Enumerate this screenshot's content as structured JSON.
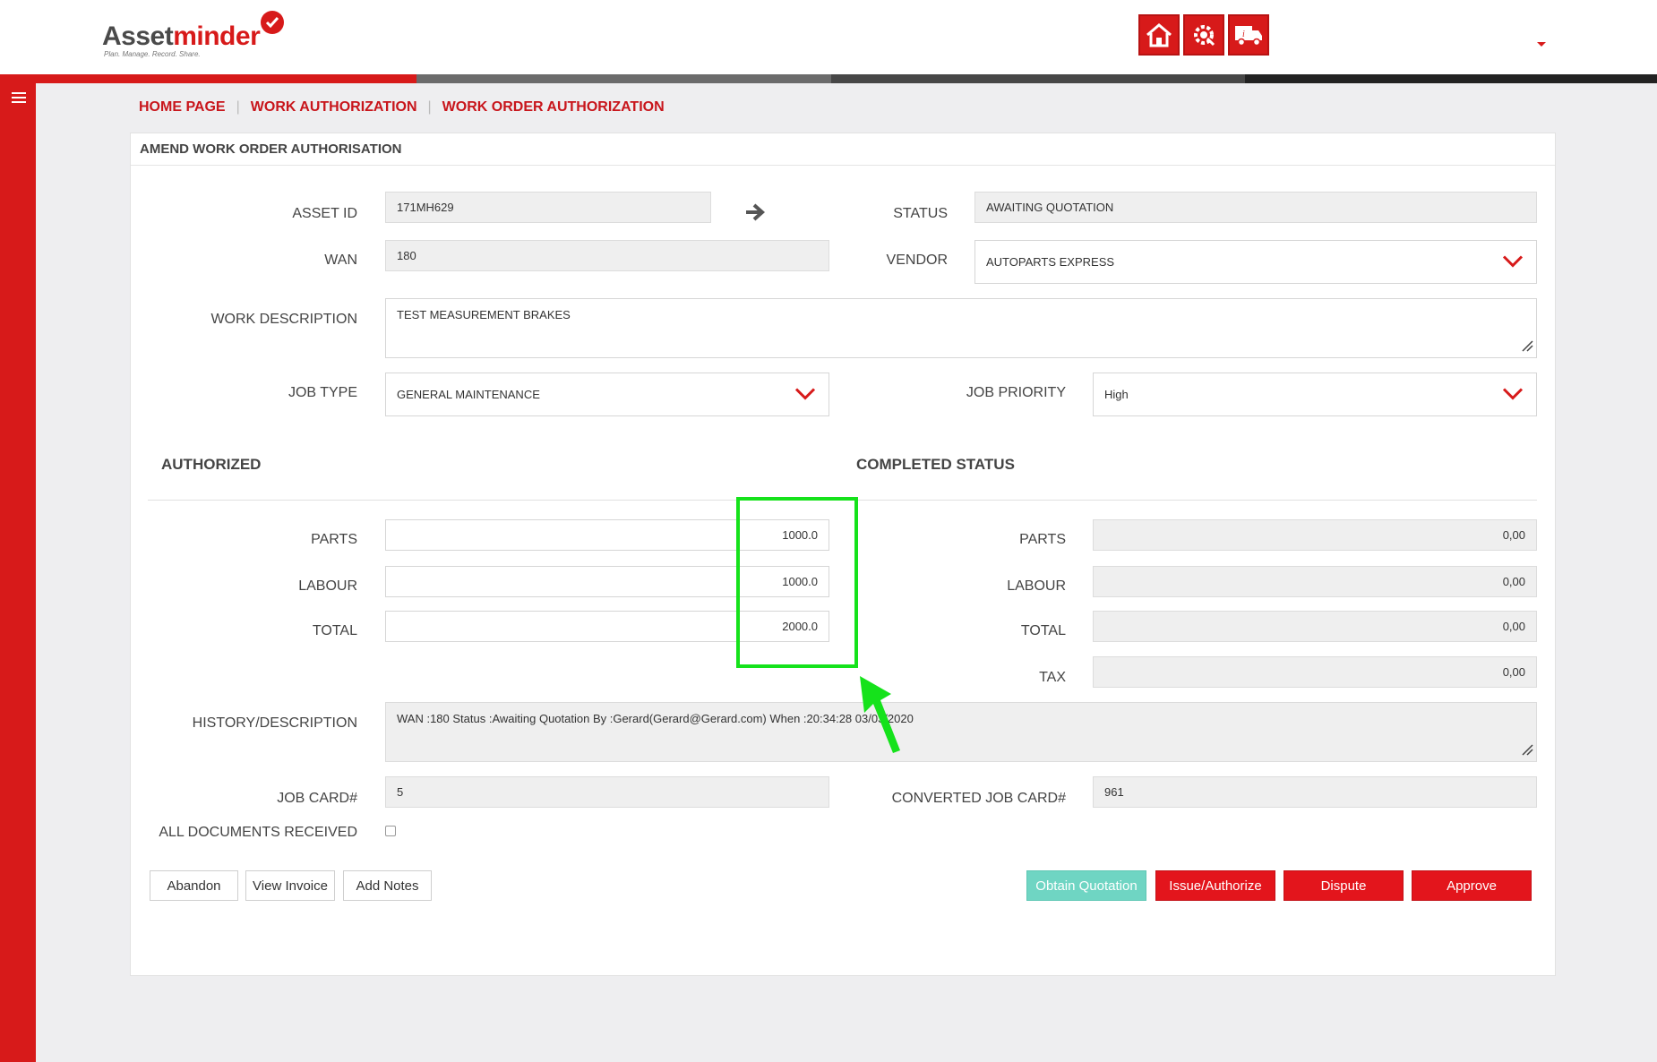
{
  "header": {
    "logo_text_dark": "Asset",
    "logo_text_red": "minder",
    "logo_tagline": "Plan. Manage. Record. Share.",
    "icons": [
      "home-icon",
      "gear-wrench-icon",
      "truck-icon"
    ]
  },
  "breadcrumb": {
    "items": [
      "HOME PAGE",
      "WORK AUTHORIZATION",
      "WORK ORDER AUTHORIZATION"
    ],
    "separator": "|"
  },
  "panel": {
    "title": "AMEND WORK ORDER AUTHORISATION"
  },
  "form": {
    "asset_id": {
      "label": "ASSET ID",
      "value": "171MH629"
    },
    "status": {
      "label": "STATUS",
      "value": "AWAITING QUOTATION"
    },
    "wan": {
      "label": "WAN",
      "value": "180"
    },
    "vendor": {
      "label": "VENDOR",
      "value": "AUTOPARTS EXPRESS"
    },
    "work_description": {
      "label": "WORK DESCRIPTION",
      "value": "TEST MEASUREMENT BRAKES"
    },
    "job_type": {
      "label": "JOB TYPE",
      "value": "GENERAL MAINTENANCE"
    },
    "job_priority": {
      "label": "JOB PRIORITY",
      "value": "High"
    }
  },
  "authorized": {
    "title": "AUTHORIZED",
    "parts": {
      "label": "PARTS",
      "value": "1000.0"
    },
    "labour": {
      "label": "LABOUR",
      "value": "1000.0"
    },
    "total": {
      "label": "TOTAL",
      "value": "2000.0"
    }
  },
  "completed": {
    "title": "COMPLETED STATUS",
    "parts": {
      "label": "PARTS",
      "value": "0,00"
    },
    "labour": {
      "label": "LABOUR",
      "value": "0,00"
    },
    "total": {
      "label": "TOTAL",
      "value": "0,00"
    },
    "tax": {
      "label": "TAX",
      "value": "0,00"
    }
  },
  "history": {
    "label": "HISTORY/DESCRIPTION",
    "value": "WAN :180 Status :Awaiting Quotation By :Gerard(Gerard@Gerard.com) When :20:34:28 03/03/2020"
  },
  "job_card": {
    "label": "JOB CARD#",
    "value": "5"
  },
  "converted_job_card": {
    "label": "CONVERTED JOB CARD#",
    "value": "961"
  },
  "all_documents": {
    "label": "ALL DOCUMENTS RECEIVED",
    "checked": false
  },
  "buttons": {
    "abandon": "Abandon",
    "view_invoice": "View Invoice",
    "add_notes": "Add Notes",
    "obtain_quotation": "Obtain Quotation",
    "issue_authorize": "Issue/Authorize",
    "dispute": "Dispute",
    "approve": "Approve"
  },
  "colors": {
    "brand_red": "#d71a1a",
    "teal": "#6fd5c3",
    "highlight_green": "#15e21b",
    "background": "#eeeef0"
  }
}
